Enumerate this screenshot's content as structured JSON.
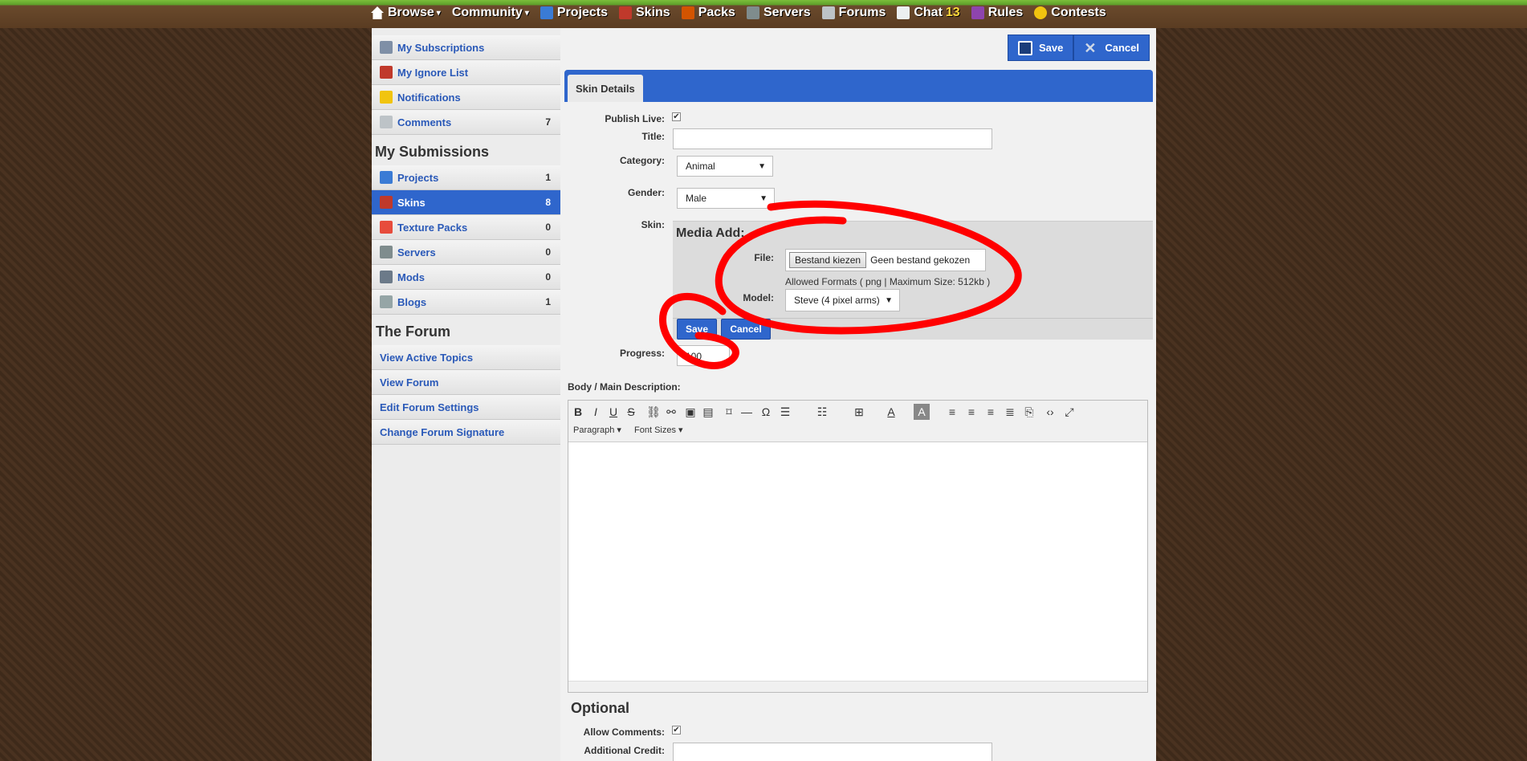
{
  "nav": {
    "items": [
      {
        "label": "Browse",
        "icon": "home-icon",
        "caret": true,
        "color": "#ffffff"
      },
      {
        "label": "Community",
        "icon": "",
        "caret": true,
        "color": "#ffffff"
      },
      {
        "label": "Projects",
        "icon": "map-icon",
        "caret": false,
        "color": "#3a7bd5"
      },
      {
        "label": "Skins",
        "icon": "skin-icon",
        "caret": false,
        "color": "#c0392b"
      },
      {
        "label": "Packs",
        "icon": "pack-icon",
        "caret": false,
        "color": "#d35400"
      },
      {
        "label": "Servers",
        "icon": "server-icon",
        "caret": false,
        "color": "#7f8c8d"
      },
      {
        "label": "Forums",
        "icon": "forum-icon",
        "caret": false,
        "color": "#bdc3c7"
      },
      {
        "label": "Chat",
        "icon": "chat-icon",
        "caret": false,
        "color": "#ecf0f1",
        "count": "13"
      },
      {
        "label": "Rules",
        "icon": "rules-icon",
        "caret": false,
        "color": "#8e44ad"
      },
      {
        "label": "Contests",
        "icon": "star-icon",
        "caret": false,
        "color": "#f1c40f"
      }
    ]
  },
  "sidebar": {
    "account": [
      {
        "label": "My Subscriptions",
        "icon": "subscriptions-icon",
        "count": ""
      },
      {
        "label": "My Ignore List",
        "icon": "ignore-icon",
        "count": ""
      },
      {
        "label": "Notifications",
        "icon": "notification-icon",
        "count": ""
      },
      {
        "label": "Comments",
        "icon": "comment-icon",
        "count": "7"
      }
    ],
    "submissions_heading": "My Submissions",
    "submissions": [
      {
        "label": "Projects",
        "icon": "projects-icon",
        "count": "1"
      },
      {
        "label": "Skins",
        "icon": "skins-icon",
        "count": "8",
        "active": true
      },
      {
        "label": "Texture Packs",
        "icon": "texture-pack-icon",
        "count": "0"
      },
      {
        "label": "Servers",
        "icon": "servers-icon",
        "count": "0"
      },
      {
        "label": "Mods",
        "icon": "mods-icon",
        "count": "0"
      },
      {
        "label": "Blogs",
        "icon": "blogs-icon",
        "count": "1"
      }
    ],
    "forum_heading": "The Forum",
    "forum": [
      {
        "label": "View Active Topics"
      },
      {
        "label": "View Forum"
      },
      {
        "label": "Edit Forum Settings"
      },
      {
        "label": "Change Forum Signature"
      }
    ]
  },
  "toolbar": {
    "save_label": "Save",
    "cancel_label": "Cancel"
  },
  "tab": {
    "label": "Skin Details"
  },
  "form": {
    "publish_label": "Publish Live:",
    "title_label": "Title:",
    "category_label": "Category:",
    "category_value": "Animal",
    "gender_label": "Gender:",
    "gender_value": "Male",
    "skin_label": "Skin:",
    "media_title": "Media Add:",
    "file_label": "File:",
    "file_button": "Bestand kiezen",
    "file_status": "Geen bestand gekozen",
    "allowed_formats": "Allowed Formats ( png | Maximum Size: 512kb )",
    "model_label": "Model:",
    "model_value": "Steve (4 pixel arms)",
    "media_save": "Save",
    "media_cancel": "Cancel",
    "progress_label": "Progress:",
    "progress_value": "100",
    "body_label": "Body / Main Description:",
    "paragraph": "Paragraph",
    "font_sizes": "Font Sizes"
  },
  "optional": {
    "heading": "Optional",
    "allow_comments_label": "Allow Comments:",
    "credit_label": "Additional Credit:"
  },
  "colors": {
    "accent": "#2f66cc",
    "annotation": "#ff0000"
  }
}
